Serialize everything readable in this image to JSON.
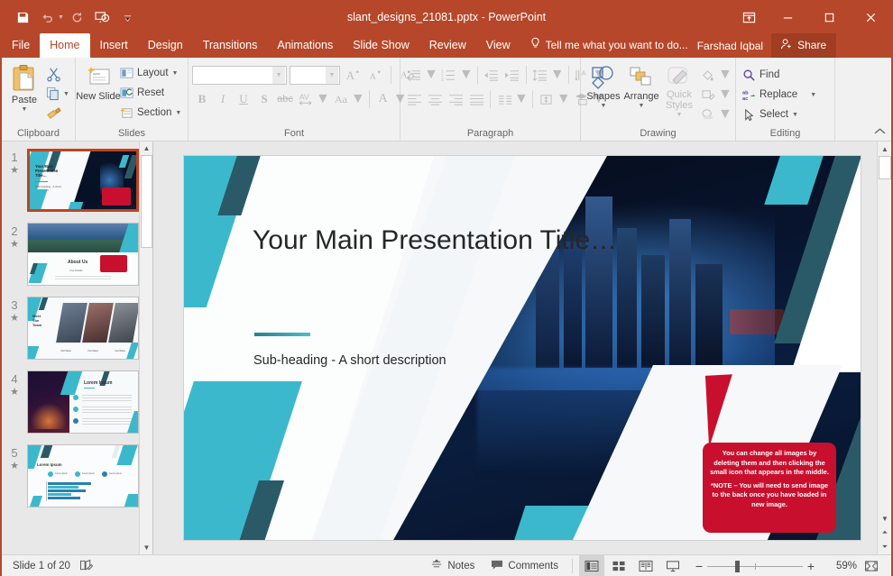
{
  "titlebar": {
    "document_title": "slant_designs_21081.pptx - PowerPoint",
    "qat": [
      {
        "name": "save-button",
        "icon": "save-icon"
      },
      {
        "name": "undo-button",
        "icon": "undo-icon"
      },
      {
        "name": "redo-button",
        "icon": "redo-icon"
      },
      {
        "name": "start-presentation-button",
        "icon": "presentation-icon"
      },
      {
        "name": "customize-qat-button",
        "icon": "chevron-down-icon"
      }
    ],
    "window_controls": {
      "ribbon_display": "ribbon-display-options-icon",
      "minimize": "minimize-icon",
      "maximize": "maximize-icon",
      "close": "close-icon"
    }
  },
  "tabs": [
    {
      "label": "File",
      "active": false
    },
    {
      "label": "Home",
      "active": true
    },
    {
      "label": "Insert",
      "active": false
    },
    {
      "label": "Design",
      "active": false
    },
    {
      "label": "Transitions",
      "active": false
    },
    {
      "label": "Animations",
      "active": false
    },
    {
      "label": "Slide Show",
      "active": false
    },
    {
      "label": "Review",
      "active": false
    },
    {
      "label": "View",
      "active": false
    }
  ],
  "tellme": {
    "placeholder": "Tell me what you want to do...",
    "user_name": "Farshad Iqbal",
    "share_label": "Share"
  },
  "ribbon": {
    "groups": [
      {
        "name": "clipboard",
        "label": "Clipboard",
        "paste_label": "Paste",
        "items": [
          "Cut",
          "Copy",
          "Format Painter"
        ]
      },
      {
        "name": "slides",
        "label": "Slides",
        "new_slide_label": "New Slide",
        "layout_label": "Layout",
        "reset_label": "Reset",
        "section_label": "Section"
      },
      {
        "name": "font",
        "label": "Font",
        "font_name_value": "",
        "font_size_value": "",
        "bold": "B",
        "italic": "I",
        "underline": "U",
        "shadow": "S",
        "strikethrough": "abc",
        "spacing": "AV",
        "change_case": "Aa",
        "font_color": "A"
      },
      {
        "name": "paragraph",
        "label": "Paragraph"
      },
      {
        "name": "drawing",
        "label": "Drawing",
        "shapes_label": "Shapes",
        "arrange_label": "Arrange",
        "quick_styles_label": "Quick Styles"
      },
      {
        "name": "editing",
        "label": "Editing",
        "find_label": "Find",
        "replace_label": "Replace",
        "select_label": "Select"
      }
    ]
  },
  "thumbnails": [
    {
      "number": "1",
      "star": "★",
      "selected": true,
      "kind": "title"
    },
    {
      "number": "2",
      "star": "★",
      "selected": false,
      "kind": "about"
    },
    {
      "number": "3",
      "star": "★",
      "selected": false,
      "kind": "team"
    },
    {
      "number": "4",
      "star": "★",
      "selected": false,
      "kind": "bullets"
    },
    {
      "number": "5",
      "star": "★",
      "selected": false,
      "kind": "chart"
    }
  ],
  "slide": {
    "title": "Your Main Presentation Title…",
    "subheading": "Sub-heading - A short description",
    "callout_paragraph_1": "You can change all images by deleting them and then clicking the small icon that appears in the middle.",
    "callout_paragraph_2": "*NOTE – You will need to send image to the back once you have loaded in new image.",
    "colors": {
      "teal": "#3bb8cc",
      "dark_teal": "#2a5a68",
      "callout_red": "#c8102e",
      "night_dark": "#05080f"
    }
  },
  "statusbar": {
    "slide_indicator": "Slide 1 of 20",
    "proofing_icon": "proofing-icon",
    "notes_label": "Notes",
    "comments_label": "Comments",
    "views": [
      {
        "name": "normal-view",
        "active": true
      },
      {
        "name": "slide-sorter-view",
        "active": false
      },
      {
        "name": "reading-view",
        "active": false
      },
      {
        "name": "slide-show-view",
        "active": false
      }
    ],
    "zoom_out": "−",
    "zoom_in": "+",
    "zoom_value": "59%",
    "fit_slide_label": "fit-slide-to-window-icon"
  }
}
